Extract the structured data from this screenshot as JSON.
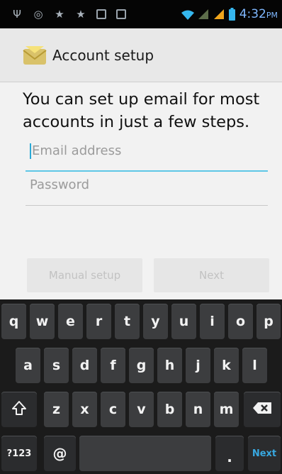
{
  "status_bar": {
    "icons": [
      "usb-icon",
      "settings-icon",
      "star-icon",
      "star-icon",
      "app-icon",
      "app-icon",
      "wifi-icon",
      "signal-sim1-icon",
      "signal-sim2-icon",
      "battery-icon"
    ],
    "time": "4:32",
    "ampm": "PM"
  },
  "header": {
    "title": "Account setup",
    "icon": "envelope-icon"
  },
  "main": {
    "intro": "You can set up email for most accounts in just a few steps.",
    "email_placeholder": "Email address",
    "password_placeholder": "Password",
    "manual_setup_label": "Manual setup",
    "next_label": "Next"
  },
  "keyboard": {
    "row1": [
      "q",
      "w",
      "e",
      "r",
      "t",
      "y",
      "u",
      "i",
      "o",
      "p"
    ],
    "row2": [
      "a",
      "s",
      "d",
      "f",
      "g",
      "h",
      "j",
      "k",
      "l"
    ],
    "row3": [
      "z",
      "x",
      "c",
      "v",
      "b",
      "n",
      "m"
    ],
    "symbols_label": "?123",
    "at_label": "@",
    "period_label": ".",
    "next_label": "Next"
  },
  "colors": {
    "accent": "#5ec7e6",
    "next_key": "#38a8e0",
    "clock": "#7fb8ff"
  }
}
